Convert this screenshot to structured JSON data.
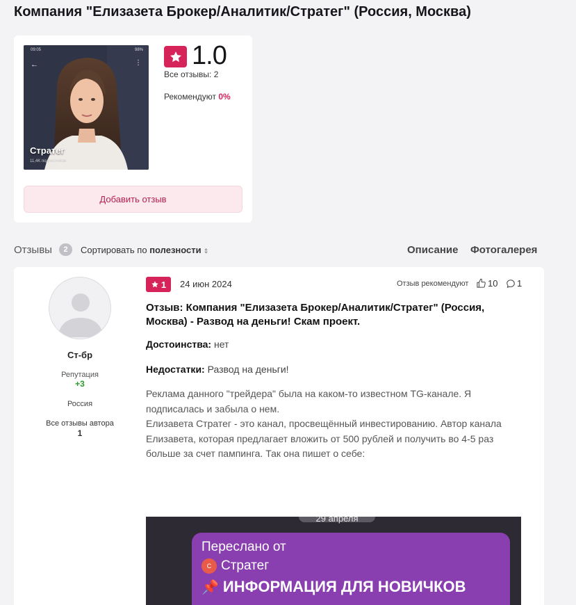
{
  "page": {
    "title": "Компания \"Елизазета Брокер/Аналитик/Стратег\" (Россия, Москва)"
  },
  "summary": {
    "photo": {
      "status_time": "09:05",
      "status_right": "98%",
      "channel_name": "Стратег",
      "subscribers": "11,4K подписчиков"
    },
    "rating": "1.0",
    "all_reviews": "Все отзывы: 2",
    "recommend_label": "Рекомендуют",
    "recommend_value": "0%",
    "add_review": "Добавить отзыв",
    "accent_color": "#d6245b"
  },
  "toolbar": {
    "reviews_label": "Отзывы",
    "reviews_count": "2",
    "sort_prefix": "Сортировать по",
    "sort_value": "полезности",
    "tabs": [
      "Описание",
      "Фотогалерея"
    ]
  },
  "review": {
    "author": {
      "name": "Ст-бр",
      "reputation_label": "Репутация",
      "reputation_value": "+3",
      "country": "Россия",
      "all_reviews_label": "Все отзывы автора",
      "all_reviews_count": "1"
    },
    "rating": "1",
    "date": "24 июн 2024",
    "recommend_text": "Отзыв рекомендуют",
    "likes": "10",
    "comments": "1",
    "title": "Отзыв: Компания \"Елизазета Брокер/Аналитик/Стратег\" (Россия, Москва) - Развод на деньги! Скам проект.",
    "pros_label": "Достоинства:",
    "pros_value": "нет",
    "cons_label": "Недостатки:",
    "cons_value": "Развод на деньги!",
    "body_p1": "Реклама данного \"трейдера\" была на каком-то известном TG-канале. Я подписалась и забыла о нем.",
    "body_p2": "Елизавета Стратег - это канал, просвещённый инвестированию. Автор канала Елизавета, которая предлагает вложить от 500 рублей и получить во 4-5 раз больше за счет пампинга. Так она пишет о себе:",
    "image": {
      "date_chip": "29 апреля",
      "forwarded": "Переслано от",
      "source_initial": "С",
      "source": "Стратег",
      "headline": "ИНФОРМАЦИЯ ДЛЯ НОВИЧКОВ"
    }
  }
}
